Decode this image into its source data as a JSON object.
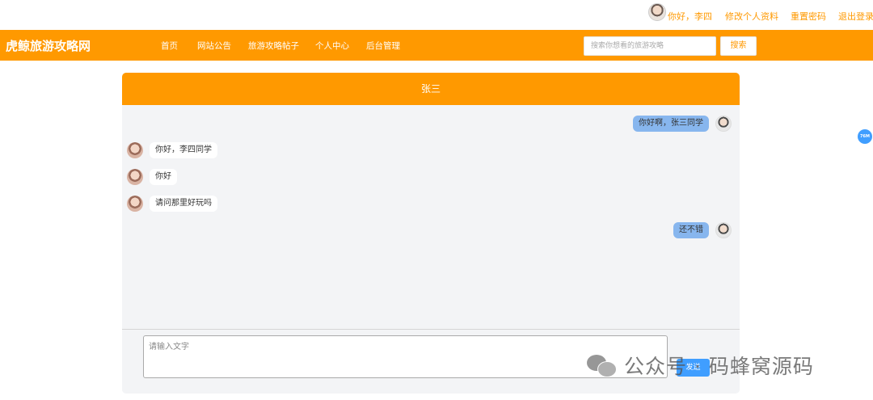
{
  "topbar": {
    "greeting": "你好，李四",
    "links": [
      "修改个人资料",
      "重置密码",
      "退出登录"
    ]
  },
  "nav": {
    "logo": "虎鲸旅游攻略网",
    "menu": [
      "首页",
      "网站公告",
      "旅游攻略帖子",
      "个人中心",
      "后台管理"
    ],
    "search_placeholder": "搜索你想看的旅游攻略",
    "search_label": "搜索"
  },
  "chat": {
    "title": "张三",
    "messages": [
      {
        "side": "right",
        "text": "你好啊，张三同学"
      },
      {
        "side": "left",
        "text": "你好，李四同学"
      },
      {
        "side": "left",
        "text": "你好"
      },
      {
        "side": "left",
        "text": "请问那里好玩吗"
      },
      {
        "side": "right",
        "text": "还不错"
      }
    ],
    "input_placeholder": "请输入文字",
    "send_label": "发送"
  },
  "badge": "76M",
  "watermark": "公众号 · 码蜂窝源码",
  "colors": {
    "primary": "#ff9900",
    "bubble_right": "#87b6ee",
    "send": "#409eff",
    "chat_bg": "#f3f4f6"
  }
}
